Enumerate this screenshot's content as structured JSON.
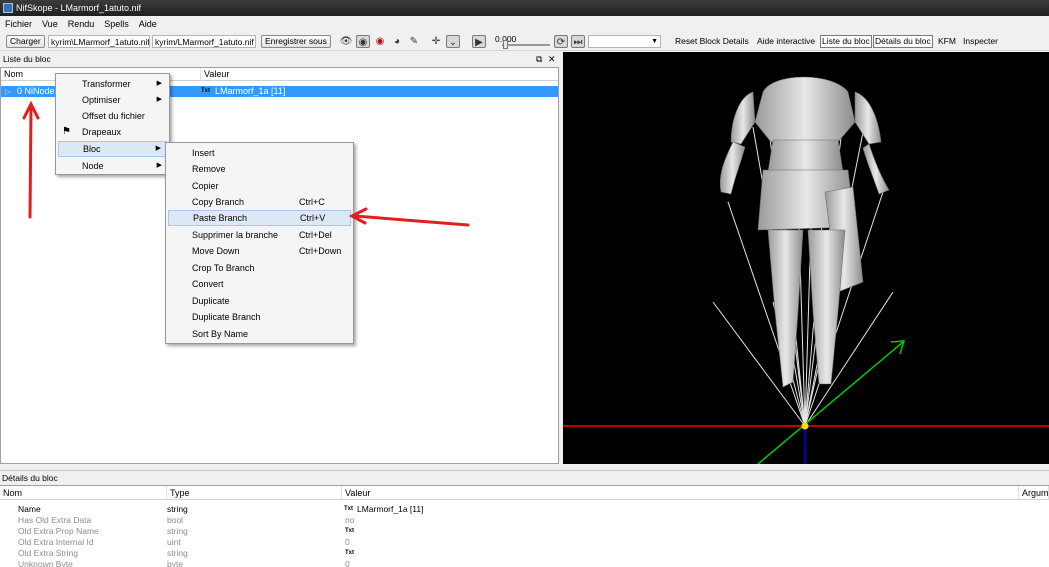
{
  "window": {
    "title": "NifSkope - LMarmorf_1atuto.nif"
  },
  "menubar": [
    "Fichier",
    "Vue",
    "Rendu",
    "Spells",
    "Aide"
  ],
  "toolbar": {
    "load_button": "Charger",
    "load_path": "kyrim\\LMarmorf_1atuto.nif",
    "save_path": "kyrim/LMarmorf_1atuto.nif",
    "save_button": "Enregistrer sous",
    "time_value": "0.000",
    "actions": [
      "Reset Block Details",
      "Aide interactive",
      "Liste du bloc",
      "Détails du bloc",
      "KFM",
      "Inspecter"
    ]
  },
  "block_list": {
    "title": "Liste du bloc",
    "columns": {
      "name": "Nom",
      "value": "Valeur"
    },
    "row": {
      "name": "0 NiNode",
      "value": "LMarmorf_1a [11]",
      "value_tag": "Txt"
    }
  },
  "context_menu": {
    "items": [
      "Transformer",
      "Optimiser",
      "Offset du fichier",
      "Drapeaux",
      "Bloc",
      "Node"
    ],
    "highlighted": "Bloc"
  },
  "submenu": {
    "items": [
      {
        "label": "Insert",
        "shortcut": ""
      },
      {
        "label": "Remove",
        "shortcut": ""
      },
      {
        "label": "Copier",
        "shortcut": ""
      },
      {
        "label": "Copy Branch",
        "shortcut": "Ctrl+C"
      },
      {
        "label": "Paste Branch",
        "shortcut": "Ctrl+V"
      },
      {
        "label": "Supprimer la branche",
        "shortcut": "Ctrl+Del"
      },
      {
        "label": "Move Down",
        "shortcut": "Ctrl+Down"
      },
      {
        "label": "Crop To Branch",
        "shortcut": ""
      },
      {
        "label": "Convert",
        "shortcut": ""
      },
      {
        "label": "Duplicate",
        "shortcut": ""
      },
      {
        "label": "Duplicate Branch",
        "shortcut": ""
      },
      {
        "label": "Sort By Name",
        "shortcut": ""
      }
    ],
    "highlighted": "Paste Branch"
  },
  "details": {
    "title": "Détails du bloc",
    "columns": {
      "name": "Nom",
      "type": "Type",
      "value": "Valeur",
      "arg": "Argum"
    },
    "rows": [
      {
        "name": "Name",
        "type": "string",
        "tag": "Txt",
        "value": "LMarmorf_1a [11]"
      },
      {
        "name": "Has Old Extra Data",
        "type": "bool",
        "tag": "",
        "value": "no"
      },
      {
        "name": "Old Extra Prop Name",
        "type": "string",
        "tag": "Txt",
        "value": ""
      },
      {
        "name": "Old Extra Internal Id",
        "type": "uint",
        "tag": "",
        "value": "0"
      },
      {
        "name": "Old Extra String",
        "type": "string",
        "tag": "Txt",
        "value": ""
      },
      {
        "name": "Unknown Byte",
        "type": "byte",
        "tag": "",
        "value": "0"
      }
    ]
  },
  "colors": {
    "selection": "#3399ff",
    "annotation_arrow": "#e41e1e",
    "viewport_bg": "#000000",
    "axis_x": "#ff0000",
    "axis_y": "#00cc00",
    "axis_z": "#0000ff"
  }
}
